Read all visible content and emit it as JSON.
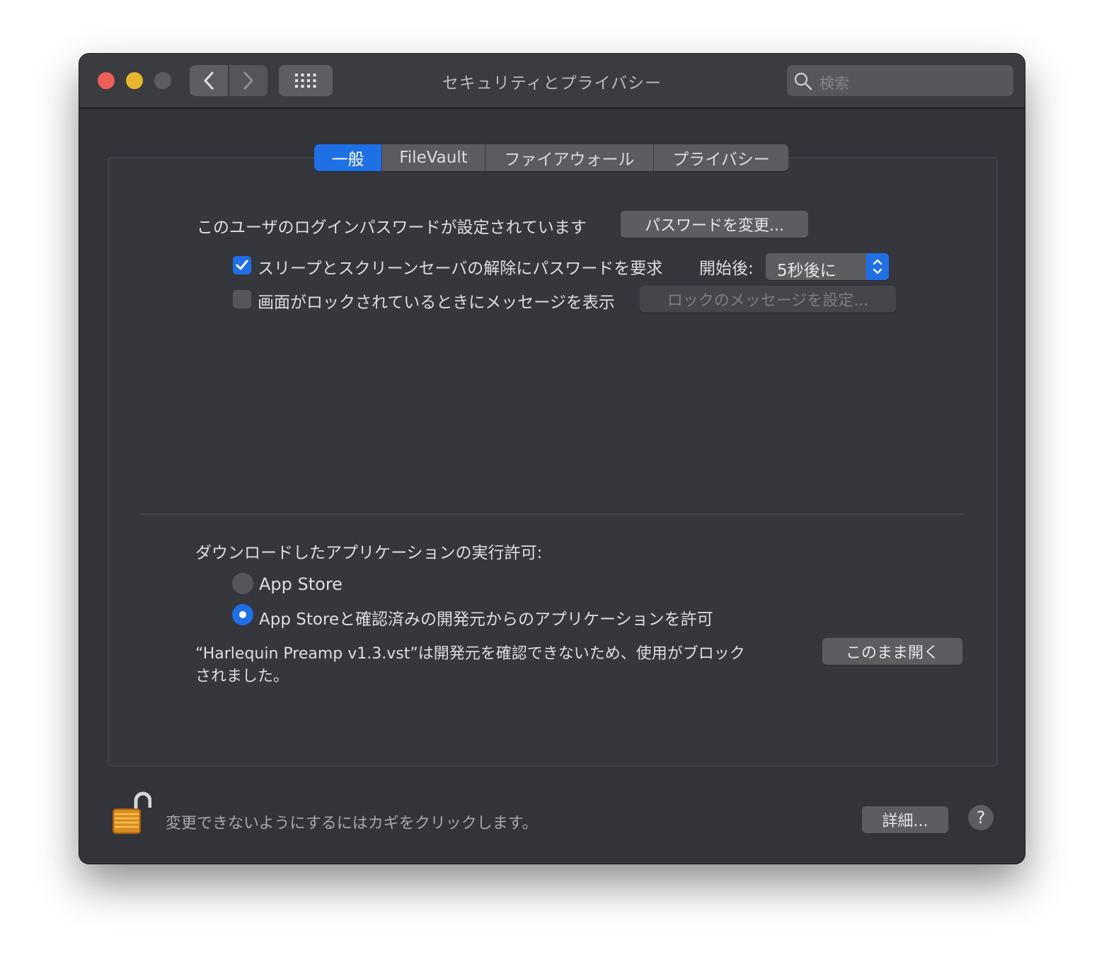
{
  "window": {
    "title": "セキュリティとプライバシー",
    "search_placeholder": "検索"
  },
  "tabs": [
    "一般",
    "FileVault",
    "ファイアウォール",
    "プライバシー"
  ],
  "general": {
    "password_label": "このユーザのログインパスワードが設定されています",
    "change_password_button": "パスワードを変更...",
    "require_password": {
      "label": "スリープとスクリーンセーバの解除にパスワードを要求",
      "checked": true,
      "after_label": "開始後:",
      "delay_value": "5秒後に"
    },
    "lock_message": {
      "label": "画面がロックされているときにメッセージを表示",
      "checked": false,
      "button": "ロックのメッセージを設定..."
    }
  },
  "downloads": {
    "heading": "ダウンロードしたアプリケーションの実行許可:",
    "options": [
      {
        "label": "App Store",
        "selected": false
      },
      {
        "label": "App Storeと確認済みの開発元からのアプリケーションを許可",
        "selected": true
      }
    ],
    "blocked_message_line1": "“Harlequin Preamp v1.3.vst”は開発元を確認できないため、使用がブロック",
    "blocked_message_line2": "されました。",
    "open_anyway_button": "このまま開く"
  },
  "footer": {
    "lock_message": "変更できないようにするにはカギをクリックします。",
    "advanced_button": "詳細...",
    "help_label": "?"
  },
  "colors": {
    "accent": "#1f6fe5",
    "close": "#ed5f57",
    "minimize": "#e8b52f",
    "zoom_disabled": "#5c5d61"
  }
}
